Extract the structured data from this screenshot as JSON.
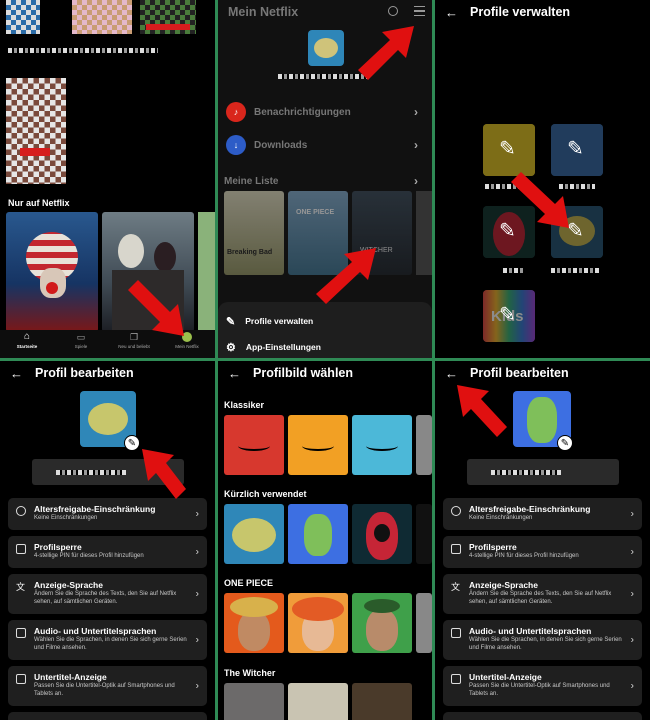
{
  "panel1": {
    "section_title": "Nur auf Netflix",
    "nav": [
      {
        "label": "Startseite",
        "icon": "home-icon",
        "active": true
      },
      {
        "label": "Spiele",
        "icon": "gamepad-icon",
        "active": false
      },
      {
        "label": "Neu und beliebt",
        "icon": "new-hot-icon",
        "active": false
      },
      {
        "label": "Mein Netflix",
        "icon": "profile-avatar-icon",
        "active": false
      }
    ]
  },
  "panel2": {
    "title": "Mein Netflix",
    "menu": [
      {
        "label": "Benachrichtigungen",
        "icon": "bell-icon",
        "color": "#d9261c"
      },
      {
        "label": "Downloads",
        "icon": "download-icon",
        "color": "#2d5cc7"
      }
    ],
    "list_title": "Meine Liste",
    "sheet": [
      {
        "label": "Profile verwalten",
        "icon": "pencil-icon"
      },
      {
        "label": "App-Einstellungen",
        "icon": "gear-icon"
      }
    ]
  },
  "panel3": {
    "title": "Profile verwalten"
  },
  "panel4": {
    "title": "Profil bearbeiten"
  },
  "panel5": {
    "title": "Profilbild wählen",
    "rows": [
      {
        "title": "Klassiker"
      },
      {
        "title": "Kürzlich verwendet"
      },
      {
        "title": "ONE PIECE"
      },
      {
        "title": "The Witcher"
      }
    ]
  },
  "panel6": {
    "title": "Profil bearbeiten"
  },
  "settings": [
    {
      "title": "Altersfreigabe-Einschränkung",
      "sub": "Keine Einschränkungen",
      "icon": "info-icon"
    },
    {
      "title": "Profilsperre",
      "sub": "4-stellige PIN für dieses Profil hinzufügen",
      "icon": "lock-icon"
    },
    {
      "title": "Anzeige-Sprache",
      "sub": "Ändern Sie die Sprache des Texts, den Sie auf Netflix sehen, auf sämtlichen Geräten.",
      "icon": "translate-icon"
    },
    {
      "title": "Audio- und Untertitelsprachen",
      "sub": "Wählen Sie die Sprachen, in denen Sie sich gerne Serien und Filme ansehen.",
      "icon": "subtitles-icon"
    },
    {
      "title": "Untertitel-Anzeige",
      "sub": "Passen Sie die Untertitel-Optik auf Smartphones und Tablets an.",
      "icon": "caption-icon"
    }
  ],
  "shared": {
    "back_glyph": "←",
    "chevron_glyph": "›",
    "pencil_glyph": "✎",
    "kids_label": "Kids",
    "breaking_bad_label": "Breaking Bad",
    "witcher_label": "WITCHER",
    "one_piece_label": "ONE PIECE"
  },
  "colors": {
    "divider": "#2f8a55",
    "arrow": "#e01010",
    "card": "#1f1f1f"
  }
}
